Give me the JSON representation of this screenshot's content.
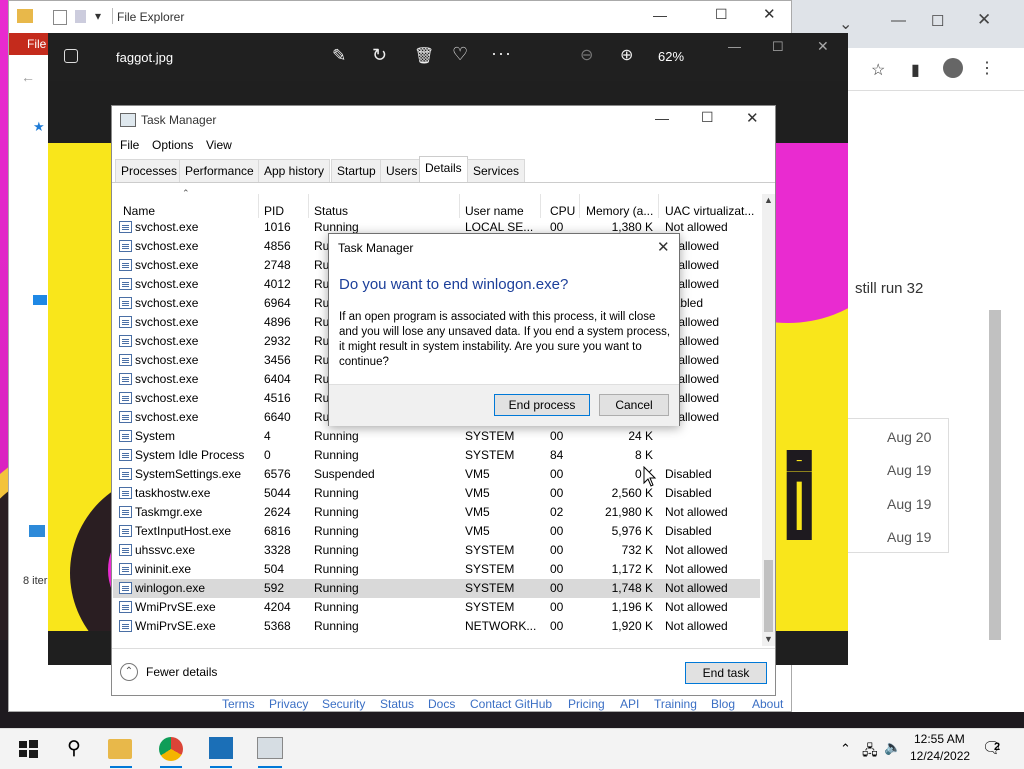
{
  "file_explorer": {
    "title": "File Explorer",
    "ribbon_file": "File",
    "status_items": "8 iter"
  },
  "chrome": {
    "text_snippet": "still run 32",
    "dates": [
      "Aug 20",
      "Aug 19",
      "Aug 19",
      "Aug 19"
    ]
  },
  "photos": {
    "filename": "faggot.jpg",
    "zoom": "62%",
    "image_letter": "i"
  },
  "task_manager": {
    "title": "Task Manager",
    "menu": [
      "File",
      "Options",
      "View"
    ],
    "tabs": [
      "Processes",
      "Performance",
      "App history",
      "Startup",
      "Users",
      "Details",
      "Services"
    ],
    "active_tab": "Details",
    "columns": [
      "Name",
      "PID",
      "Status",
      "User name",
      "CPU",
      "Memory (a...",
      "UAC virtualizat..."
    ],
    "rows": [
      {
        "name": "svchost.exe",
        "pid": "1016",
        "status": "Running",
        "user": "LOCAL SE...",
        "cpu": "00",
        "mem": "1,380 K",
        "uac": "Not allowed"
      },
      {
        "name": "svchost.exe",
        "pid": "4856",
        "status": "Ru",
        "user": "",
        "cpu": "",
        "mem": "",
        "uac": "ot allowed"
      },
      {
        "name": "svchost.exe",
        "pid": "2748",
        "status": "Ru",
        "user": "",
        "cpu": "",
        "mem": "",
        "uac": "ot allowed"
      },
      {
        "name": "svchost.exe",
        "pid": "4012",
        "status": "Ru",
        "user": "",
        "cpu": "",
        "mem": "",
        "uac": "ot allowed"
      },
      {
        "name": "svchost.exe",
        "pid": "6964",
        "status": "Ru",
        "user": "",
        "cpu": "",
        "mem": "",
        "uac": "isabled"
      },
      {
        "name": "svchost.exe",
        "pid": "4896",
        "status": "Ru",
        "user": "",
        "cpu": "",
        "mem": "",
        "uac": "ot allowed"
      },
      {
        "name": "svchost.exe",
        "pid": "2932",
        "status": "Ru",
        "user": "",
        "cpu": "",
        "mem": "",
        "uac": "ot allowed"
      },
      {
        "name": "svchost.exe",
        "pid": "3456",
        "status": "Ru",
        "user": "",
        "cpu": "",
        "mem": "",
        "uac": "ot allowed"
      },
      {
        "name": "svchost.exe",
        "pid": "6404",
        "status": "Ru",
        "user": "",
        "cpu": "",
        "mem": "",
        "uac": "ot allowed"
      },
      {
        "name": "svchost.exe",
        "pid": "4516",
        "status": "Ru",
        "user": "",
        "cpu": "",
        "mem": "",
        "uac": "ot allowed"
      },
      {
        "name": "svchost.exe",
        "pid": "6640",
        "status": "Ru",
        "user": "",
        "cpu": "",
        "mem": "",
        "uac": "ot allowed"
      },
      {
        "name": "System",
        "pid": "4",
        "status": "Running",
        "user": "SYSTEM",
        "cpu": "00",
        "mem": "24 K",
        "uac": ""
      },
      {
        "name": "System Idle Process",
        "pid": "0",
        "status": "Running",
        "user": "SYSTEM",
        "cpu": "84",
        "mem": "8 K",
        "uac": ""
      },
      {
        "name": "SystemSettings.exe",
        "pid": "6576",
        "status": "Suspended",
        "user": "VM5",
        "cpu": "00",
        "mem": "0 K",
        "uac": "Disabled"
      },
      {
        "name": "taskhostw.exe",
        "pid": "5044",
        "status": "Running",
        "user": "VM5",
        "cpu": "00",
        "mem": "2,560 K",
        "uac": "Disabled"
      },
      {
        "name": "Taskmgr.exe",
        "pid": "2624",
        "status": "Running",
        "user": "VM5",
        "cpu": "02",
        "mem": "21,980 K",
        "uac": "Not allowed"
      },
      {
        "name": "TextInputHost.exe",
        "pid": "6816",
        "status": "Running",
        "user": "VM5",
        "cpu": "00",
        "mem": "5,976 K",
        "uac": "Disabled"
      },
      {
        "name": "uhssvc.exe",
        "pid": "3328",
        "status": "Running",
        "user": "SYSTEM",
        "cpu": "00",
        "mem": "732 K",
        "uac": "Not allowed"
      },
      {
        "name": "wininit.exe",
        "pid": "504",
        "status": "Running",
        "user": "SYSTEM",
        "cpu": "00",
        "mem": "1,172 K",
        "uac": "Not allowed"
      },
      {
        "name": "winlogon.exe",
        "pid": "592",
        "status": "Running",
        "user": "SYSTEM",
        "cpu": "00",
        "mem": "1,748 K",
        "uac": "Not allowed"
      },
      {
        "name": "WmiPrvSE.exe",
        "pid": "4204",
        "status": "Running",
        "user": "SYSTEM",
        "cpu": "00",
        "mem": "1,196 K",
        "uac": "Not allowed"
      },
      {
        "name": "WmiPrvSE.exe",
        "pid": "5368",
        "status": "Running",
        "user": "NETWORK...",
        "cpu": "00",
        "mem": "1,920 K",
        "uac": "Not allowed"
      }
    ],
    "selected_row": "winlogon.exe",
    "fewer_details": "Fewer details",
    "end_task": "End task"
  },
  "dialog": {
    "title": "Task Manager",
    "heading": "Do you want to end winlogon.exe?",
    "body": "If an open program is associated with this process, it will close and you will lose any unsaved data. If you end a system process, it might result in system instability. Are you sure you want to continue?",
    "end_process": "End process",
    "cancel": "Cancel"
  },
  "github_footer": [
    "Terms",
    "Privacy",
    "Security",
    "Status",
    "Docs",
    "Contact GitHub",
    "Pricing",
    "API",
    "Training",
    "Blog",
    "About"
  ],
  "taskbar": {
    "time": "12:55 AM",
    "date": "12/24/2022",
    "notifications": "2"
  },
  "colors": {
    "accent": "#0078d7",
    "wallpaper_pink": "#e92bd0",
    "photo_yellow": "#f9e61b",
    "file_ribbon": "#c42b1c"
  }
}
